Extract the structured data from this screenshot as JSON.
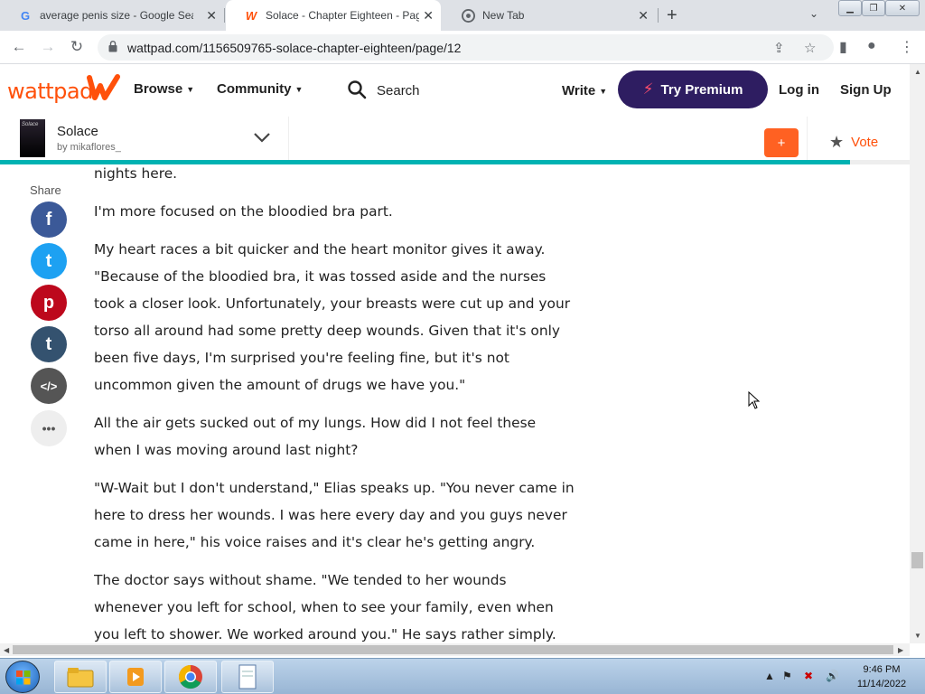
{
  "browser": {
    "tabs": [
      {
        "title": "average penis size - Google Sear",
        "favicon": "google-g-icon"
      },
      {
        "title": "Solace - Chapter Eighteen - Page",
        "favicon": "wattpad-w-icon",
        "active": true
      },
      {
        "title": "New Tab",
        "favicon": "chrome-icon"
      }
    ],
    "url": "wattpad.com/1156509765-solace-chapter-eighteen/page/12"
  },
  "wattpad": {
    "logo_text": "wattpad",
    "nav": {
      "browse": "Browse",
      "community": "Community",
      "search": "Search",
      "write": "Write"
    },
    "premium_label": "Try Premium",
    "login_label": "Log in",
    "signup_label": "Sign Up"
  },
  "story": {
    "cover_text": "Solace",
    "title": "Solace",
    "author": "by mikaflores_",
    "add_label": "+",
    "vote_label": "Vote",
    "reading_progress": 0.93
  },
  "share": {
    "label": "Share",
    "buttons": [
      {
        "name": "facebook",
        "glyph": "f",
        "color": "#3b5998"
      },
      {
        "name": "twitter",
        "glyph": "t",
        "color": "#1da1f2"
      },
      {
        "name": "pinterest",
        "glyph": "p",
        "color": "#bd081c"
      },
      {
        "name": "tumblr",
        "glyph": "t",
        "color": "#34526f"
      },
      {
        "name": "embed",
        "glyph": "</>",
        "color": "#555555"
      },
      {
        "name": "more",
        "glyph": "•••",
        "color": "#eeeeee"
      }
    ]
  },
  "paragraphs": [
    "nights here.",
    "I'm more focused on the bloodied bra part.",
    "My heart races a bit quicker and the heart monitor gives it away. \"Because of the bloodied bra, it was tossed aside and the nurses took a closer look. Unfortunately, your breasts were cut up and your torso all around had some pretty deep wounds. Given that it's only been five days, I'm surprised you're feeling fine, but it's not uncommon given the amount of drugs we have you.\"",
    "All the air gets sucked out of my lungs. How did I not feel these when I was moving around last night?",
    "\"W-Wait but I don't understand,\" Elias speaks up. \"You never came in here to dress her wounds. I was here every day and you guys never came in here,\" his voice raises and it's clear he's getting angry.",
    "The doctor says without shame. \"We tended to her wounds whenever you left for school, when to see your family, even when you left to shower. We worked around you.\" He says rather simply."
  ],
  "taskbar": {
    "time": "9:46 PM",
    "date": "11/14/2022"
  }
}
